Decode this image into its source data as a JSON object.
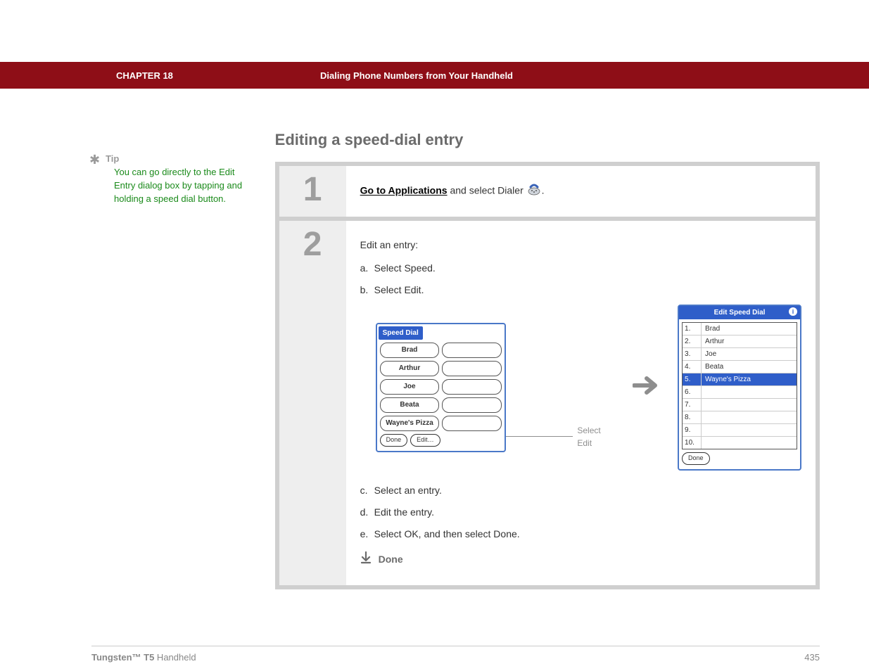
{
  "header": {
    "chapter": "CHAPTER 18",
    "title": "Dialing Phone Numbers from Your Handheld"
  },
  "sidebar": {
    "tip_label": "Tip",
    "tip_text": "You can go directly to the Edit Entry dialog box by tapping and holding a speed dial button."
  },
  "main": {
    "title": "Editing a speed-dial entry"
  },
  "step1": {
    "num": "1",
    "link": "Go to Applications",
    "rest": " and select Dialer ",
    "period": "."
  },
  "step2": {
    "num": "2",
    "intro": "Edit an entry:",
    "a_letter": "a.",
    "a_text": "Select Speed.",
    "b_letter": "b.",
    "b_text": "Select Edit.",
    "c_letter": "c.",
    "c_text": "Select an entry.",
    "d_letter": "d.",
    "d_text": "Edit the entry.",
    "e_letter": "e.",
    "e_text": "Select OK, and then select Done.",
    "done_label": "Done",
    "select_edit_label": "Select Edit"
  },
  "speed_dial": {
    "tab": "Speed Dial",
    "entries": [
      "Brad",
      "Arthur",
      "Joe",
      "Beata",
      "Wayne's Pizza"
    ],
    "done": "Done",
    "edit": "Edit…"
  },
  "edit_dialog": {
    "title": "Edit Speed Dial",
    "rows": [
      {
        "n": "1.",
        "name": "Brad"
      },
      {
        "n": "2.",
        "name": "Arthur"
      },
      {
        "n": "3.",
        "name": "Joe"
      },
      {
        "n": "4.",
        "name": "Beata"
      },
      {
        "n": "5.",
        "name": "Wayne's Pizza",
        "selected": true
      },
      {
        "n": "6.",
        "name": ""
      },
      {
        "n": "7.",
        "name": ""
      },
      {
        "n": "8.",
        "name": ""
      },
      {
        "n": "9.",
        "name": ""
      },
      {
        "n": "10.",
        "name": ""
      }
    ],
    "done": "Done"
  },
  "footer": {
    "product_bold": "Tungsten™ T5",
    "product_rest": " Handheld",
    "page": "435"
  }
}
